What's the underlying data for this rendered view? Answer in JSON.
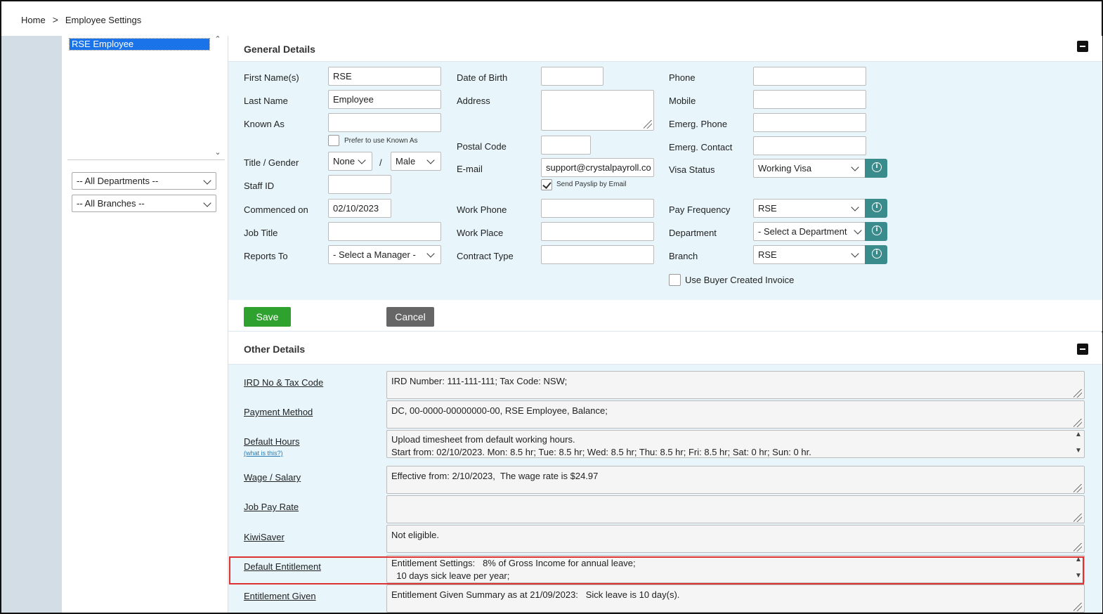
{
  "breadcrumb": {
    "home": "Home",
    "sep": ">",
    "current": "Employee Settings"
  },
  "sidebar": {
    "employees": [
      "RSE Employee"
    ],
    "departments_select": "-- All Departments --",
    "branches_select": "-- All Branches --"
  },
  "general": {
    "title": "General Details",
    "first_name": {
      "label": "First Name(s)",
      "value": "RSE"
    },
    "last_name": {
      "label": "Last Name",
      "value": "Employee"
    },
    "known_as": {
      "label": "Known As",
      "value": ""
    },
    "prefer_known_as": "Prefer to use Known As",
    "title_gender": {
      "label": "Title / Gender",
      "title": "None",
      "sep": "/",
      "gender": "Male"
    },
    "staff_id": {
      "label": "Staff ID",
      "value": ""
    },
    "commenced": {
      "label": "Commenced on",
      "value": "02/10/2023"
    },
    "job_title": {
      "label": "Job Title",
      "value": ""
    },
    "reports_to": {
      "label": "Reports To",
      "value": "- Select a Manager -"
    },
    "dob": {
      "label": "Date of Birth",
      "value": ""
    },
    "address": {
      "label": "Address",
      "value": ""
    },
    "postal_code": {
      "label": "Postal Code",
      "value": ""
    },
    "email": {
      "label": "E-mail",
      "value": "support@crystalpayroll.co"
    },
    "send_payslip": "Send Payslip by Email",
    "work_phone": {
      "label": "Work Phone",
      "value": ""
    },
    "work_place": {
      "label": "Work Place",
      "value": ""
    },
    "contract_type": {
      "label": "Contract Type",
      "value": ""
    },
    "phone": {
      "label": "Phone",
      "value": ""
    },
    "mobile": {
      "label": "Mobile",
      "value": ""
    },
    "emerg_phone": {
      "label": "Emerg. Phone",
      "value": ""
    },
    "emerg_contact": {
      "label": "Emerg. Contact",
      "value": ""
    },
    "visa": {
      "label": "Visa Status",
      "value": "Working Visa"
    },
    "pay_freq": {
      "label": "Pay Frequency",
      "value": "RSE"
    },
    "department": {
      "label": "Department",
      "value": "- Select a Department"
    },
    "branch": {
      "label": "Branch",
      "value": "RSE"
    },
    "buyer_invoice": "Use Buyer Created Invoice"
  },
  "buttons": {
    "save": "Save",
    "cancel": "Cancel"
  },
  "other": {
    "title": "Other Details",
    "what_is_this": "(what is this?)",
    "rows": [
      {
        "label": "IRD No & Tax Code",
        "value": "IRD Number: 111-111-111; Tax Code: NSW;"
      },
      {
        "label": "Payment Method",
        "value": "DC, 00-0000-00000000-00, RSE Employee, Balance;"
      },
      {
        "label": "Default Hours",
        "value": "Upload timesheet from default working hours.\nStart from: 02/10/2023. Mon: 8.5 hr; Tue: 8.5 hr; Wed: 8.5 hr; Thu: 8.5 hr; Fri: 8.5 hr; Sat: 0 hr; Sun: 0 hr."
      },
      {
        "label": "Wage / Salary",
        "value": "Effective from: 2/10/2023,  The wage rate is $24.97"
      },
      {
        "label": "Job Pay Rate",
        "value": ""
      },
      {
        "label": "KiwiSaver",
        "value": "Not eligible."
      },
      {
        "label": "Default Entitlement",
        "value": "Entitlement Settings:   8% of Gross Income for annual leave;\n  10 days sick leave per year;"
      },
      {
        "label": "Entitlement Given",
        "value": "Entitlement Given Summary as at 21/09/2023:   Sick leave is 10 day(s)."
      }
    ]
  },
  "colors": {
    "accent": "#3a8b8b",
    "save": "#2ea12e",
    "cancel": "#666666",
    "highlight": "#dd3333",
    "panel_bg": "#e8f6fc"
  }
}
